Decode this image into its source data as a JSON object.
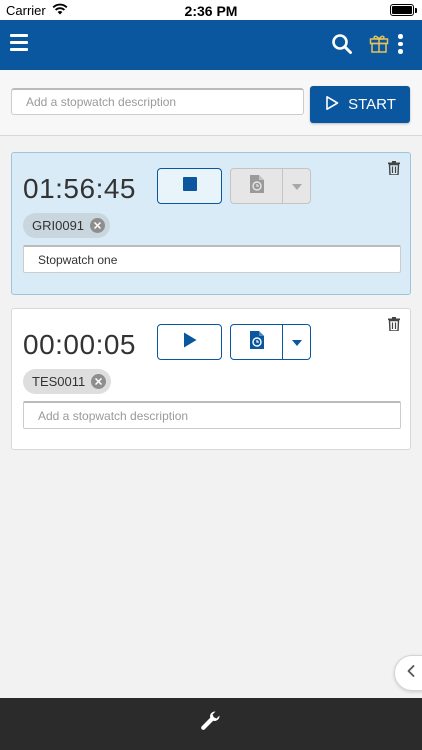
{
  "status_bar": {
    "carrier": "Carrier",
    "time": "2:36 PM",
    "battery_level": 1.0
  },
  "header": {
    "icons": [
      "menu-icon",
      "search-icon",
      "gift-icon",
      "more-vert-icon"
    ],
    "colors": {
      "bar": "#0a57a0",
      "gift": "#e6c25a"
    }
  },
  "new_stopwatch": {
    "placeholder": "Add a stopwatch description",
    "start_label": "START",
    "start_icon": "play-outline-icon"
  },
  "stopwatches": [
    {
      "time": "01:56:45",
      "running": true,
      "control_icon": "stop-icon",
      "log_enabled": false,
      "tag": "GRI0091",
      "description": "Stopwatch one",
      "placeholder": "Add a stopwatch description",
      "background": "#d8ebf6"
    },
    {
      "time": "00:00:05",
      "running": false,
      "control_icon": "play-icon",
      "log_enabled": true,
      "tag": "TES0011",
      "description": "",
      "placeholder": "Add a stopwatch description",
      "background": "#ffffff"
    }
  ],
  "footer": {
    "icons": [
      "chevron-left-icon",
      "wrench-icon"
    ]
  }
}
